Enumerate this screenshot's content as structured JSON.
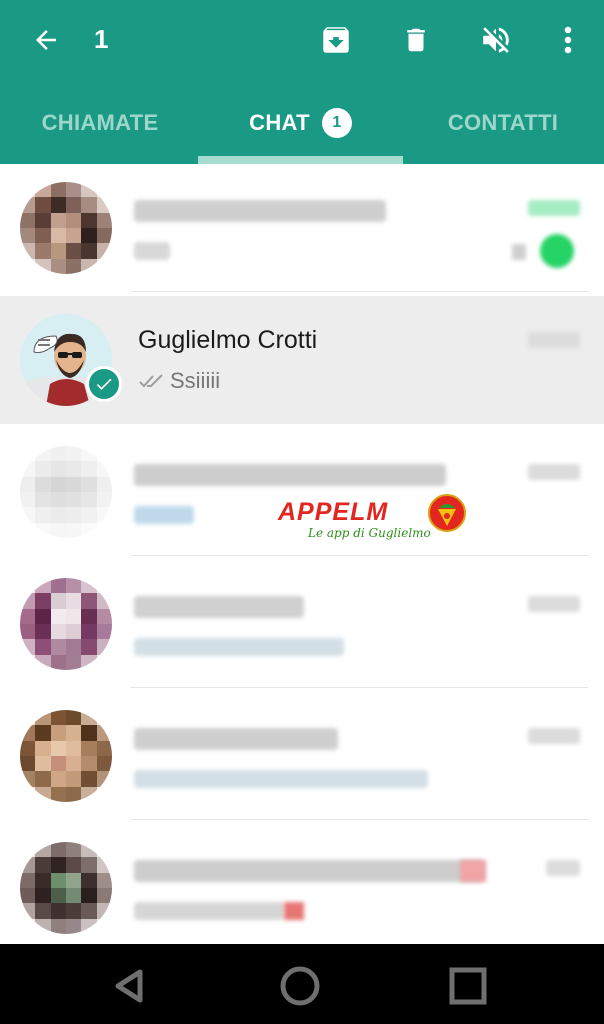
{
  "header": {
    "selected_count": "1",
    "back_icon": "arrow-left-icon",
    "actions": [
      {
        "name": "archive-icon"
      },
      {
        "name": "delete-icon"
      },
      {
        "name": "mute-icon"
      },
      {
        "name": "more-vert-icon"
      }
    ]
  },
  "tabs": [
    {
      "label": "CHIAMATE",
      "active": false
    },
    {
      "label": "CHAT",
      "active": true,
      "badge": "1"
    },
    {
      "label": "CONTATTI",
      "active": false
    }
  ],
  "chats": [
    {
      "name": "",
      "message": "",
      "time": "",
      "blurred": true
    },
    {
      "name": "Guglielmo Crotti",
      "message": "Ssiiiii",
      "time": "",
      "blurred": false,
      "selected": true
    },
    {
      "name": "",
      "message": "",
      "time": "",
      "blurred": true
    },
    {
      "name": "",
      "message": "",
      "time": "",
      "blurred": true
    },
    {
      "name": "",
      "message": "",
      "time": "",
      "blurred": true
    },
    {
      "name": "",
      "message": "",
      "time": "",
      "blurred": true
    }
  ],
  "watermark": {
    "title_part1": "APPELM",
    "subtitle": "Le app di Guglielmo"
  },
  "colors": {
    "primary": "#1a9a84",
    "tab_inactive": "#9fd6cb",
    "indicator": "#a6dccf",
    "unread_green": "#25d366"
  },
  "navbar": {
    "buttons": [
      {
        "name": "back-nav-icon"
      },
      {
        "name": "home-nav-icon"
      },
      {
        "name": "recents-nav-icon"
      }
    ]
  }
}
